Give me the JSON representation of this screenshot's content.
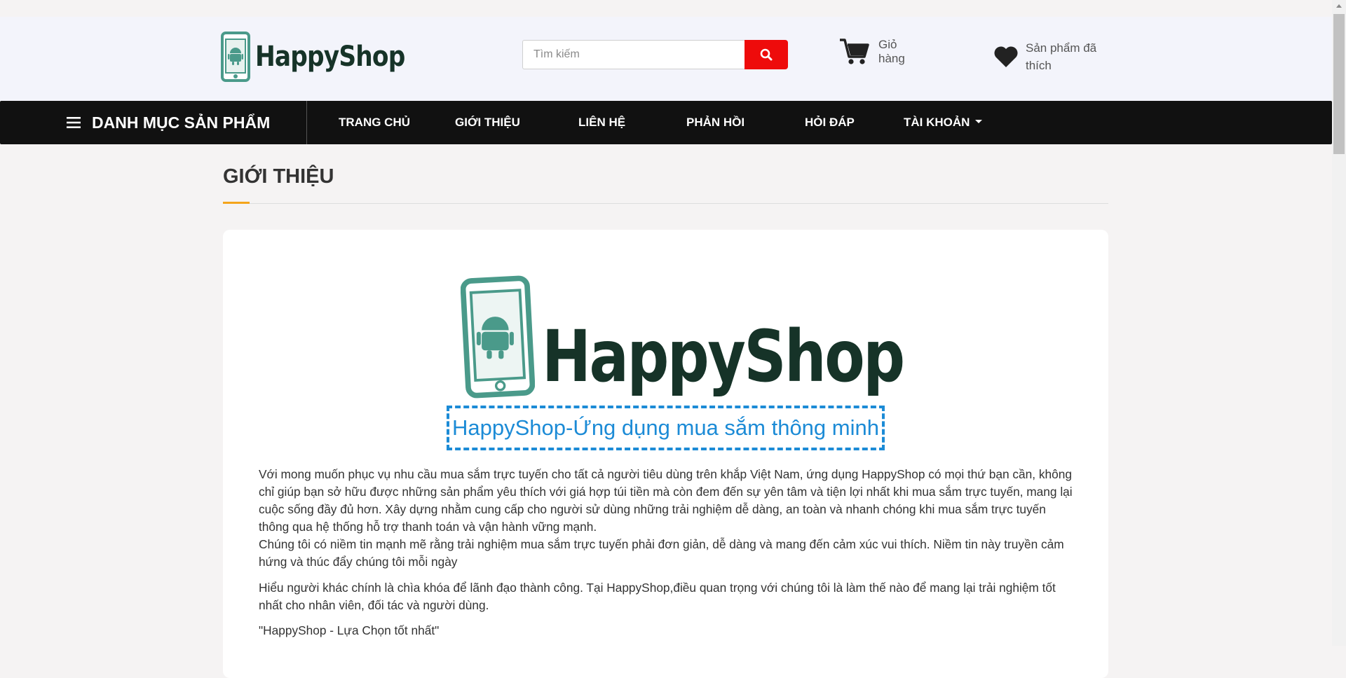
{
  "header": {
    "logo_text": "HappyShop",
    "search": {
      "placeholder": "Tìm kiếm"
    },
    "cart_label": "Giỏ hàng",
    "favorites_label": "Sản phẩm đã thích"
  },
  "nav": {
    "category_label": "DANH MỤC SẢN PHẨM",
    "items": [
      "TRANG CHỦ",
      "GIỚI THIỆU",
      "LIÊN HỆ",
      "PHẢN HỒI",
      "HỎI ĐÁP",
      "TÀI KHOẢN"
    ]
  },
  "page": {
    "title": "GIỚI THIỆU",
    "logo_text": "HappyShop",
    "tagline": "HappyShop-Ứng dụng mua sắm thông minh",
    "paragraphs": [
      "Với mong muốn phục vụ nhu cầu mua sắm trực tuyến cho tất cả người tiêu dùng trên khắp Việt Nam, ứng dụng HappyShop có mọi thứ bạn cần, không chỉ giúp bạn sở hữu được những sản phẩm yêu thích với giá hợp túi tiền mà còn đem đến sự yên tâm và tiện lợi nhất khi mua sắm trực tuyến, mang lại cuộc sống đầy đủ hơn. Xây dựng nhằm cung cấp cho người sử dùng những trải nghiệm dễ dàng, an toàn và nhanh chóng khi mua sắm trực tuyến thông qua hệ thống hỗ trợ thanh toán và vận hành vững mạnh.",
      "Chúng tôi có niềm tin mạnh mẽ rằng trải nghiệm mua sắm trực tuyến phải đơn giản, dễ dàng và mang đến cảm xúc vui thích. Niềm tin này truyền cảm hứng và thúc đẩy chúng tôi mỗi ngày",
      "Hiểu người khác chính là chìa khóa để lãnh đạo thành công. Tại HappyShop,điều quan trọng với chúng tôi là làm thế nào để mang lại trải nghiệm tốt nhất cho nhân viên, đối tác và người dùng.",
      "\"HappyShop - Lựa Chọn tốt nhất\""
    ]
  },
  "colors": {
    "brand_dark": "#163328",
    "brand_teal": "#4a9a8a",
    "search_button": "#ee0b0b",
    "navbar": "#111111",
    "accent": "#f4a41b",
    "tagline": "#1c8bd6"
  },
  "icons": {
    "search": "search-icon",
    "cart": "cart-icon",
    "heart": "heart-icon",
    "menu": "hamburger-icon",
    "caret": "caret-down-icon",
    "logo": "phone-android-logo-icon"
  }
}
